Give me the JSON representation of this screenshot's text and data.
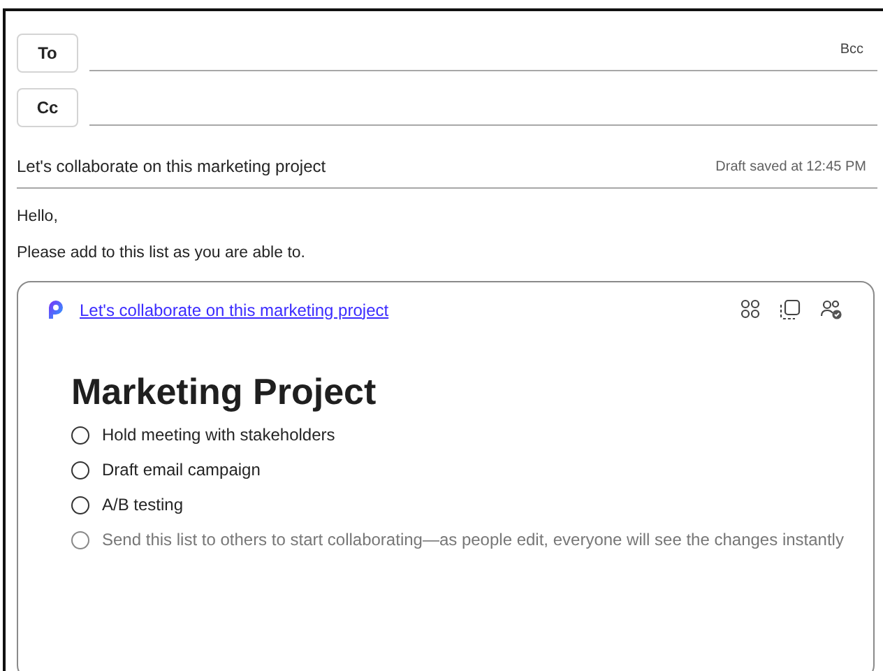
{
  "recipients": [
    {
      "label": "To",
      "trailing": "Bcc"
    },
    {
      "label": "Cc"
    }
  ],
  "subject": {
    "value": "Let's collaborate on this marketing project",
    "status": "Draft saved at 12:45 PM"
  },
  "body": [
    "Hello,",
    "Please add to this list as you are able to."
  ],
  "loop_card": {
    "link": "Let's collaborate on this marketing project",
    "title": "Marketing Project",
    "items": [
      {
        "kind": "task",
        "text": "Hold meeting with stakeholders",
        "checked": false
      },
      {
        "kind": "task",
        "text": "Draft email campaign",
        "checked": false
      },
      {
        "kind": "task",
        "text": "A/B testing",
        "checked": false
      },
      {
        "kind": "placeholder",
        "text": "Send this list to others to start collaborating—as people edit, everyone will see the changes instantly",
        "checked": false
      }
    ]
  }
}
